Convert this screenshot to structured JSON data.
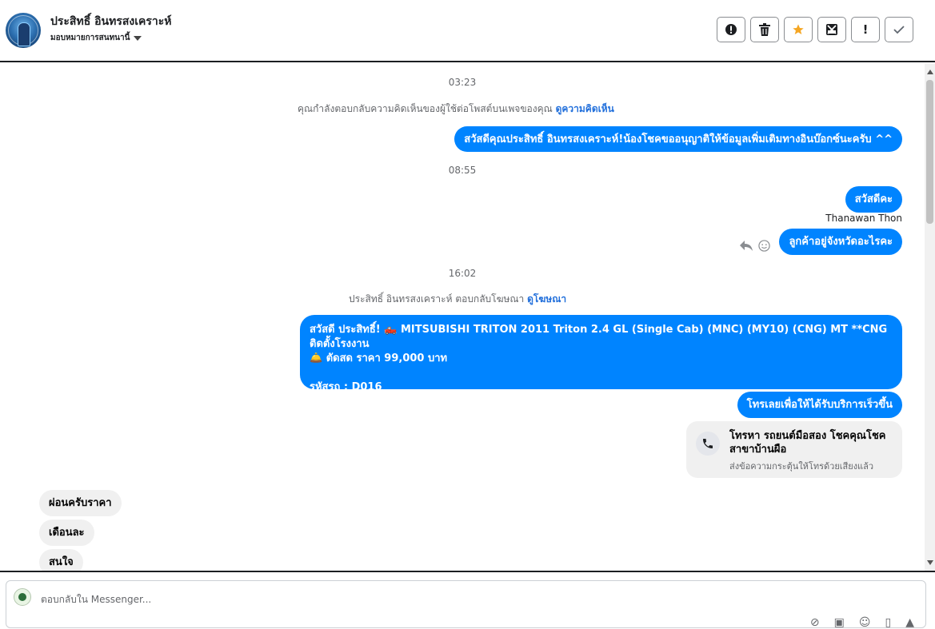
{
  "header": {
    "name": "ประสิทธิ์ อินทรสงเคราะห์",
    "assign_label": "มอบหมายการสนทนานี้",
    "tools": [
      "spam-icon",
      "trash-icon",
      "star-icon",
      "archive-icon",
      "important-icon",
      "done-icon"
    ],
    "tool_labels": {
      "important": "!",
      "done": "✓"
    }
  },
  "thread": {
    "ts1": "03:23",
    "sys1_text": "คุณกำลังตอบกลับความคิดเห็นของผู้ใช้ต่อโพสต์บนเพจของคุณ",
    "sys1_link": "ดูความคิดเห็น",
    "msg1": "สวัสดีคุณประสิทธิ์ อินทรสงเคราะห์!น้องโชคขออนุญาติให้ข้อมูลเพิ่มเติมทางอินบ๊อกซ์นะครับ ^^",
    "ts2": "08:55",
    "msg2": "สวัสดีคะ",
    "sender": "Thanawan Thon",
    "msg3": "ลูกค้าอยู่จังหวัดอะไรคะ",
    "ts3": "16:02",
    "sys2_text": "ประสิทธิ์ อินทรสงเคราะห์ ตอบกลับโฆษณา",
    "sys2_link": "ดูโฆษณา",
    "ad_line1": "สวัสดี ประสิทธิ์! 🛻  MITSUBISHI TRITON 2011 Triton 2.4 GL (Single Cab) (MNC) (MY10) (CNG) MT **CNG ติดตั้งโรงงาน",
    "ad_line2": "🛎️  ตัดสด ราคา 99,000 บาท",
    "ad_line3": "รหัสรถ : D016",
    "msg4": "โทรเลยเพื่อให้ได้รับบริการเร็วขึ้น",
    "call_title": "โทรหา รถยนต์มือสอง โชคคุณโชค สาขาบ้านผือ",
    "call_sub": "ส่งข้อความกระตุ้นให้โทรด้วยเสียงแล้ว",
    "in1": "ผ่อนครับราคา",
    "in2": "เดือนละ",
    "in3": "สนใจ"
  },
  "composer": {
    "placeholder": "ตอบกลับใน Messenger..."
  }
}
